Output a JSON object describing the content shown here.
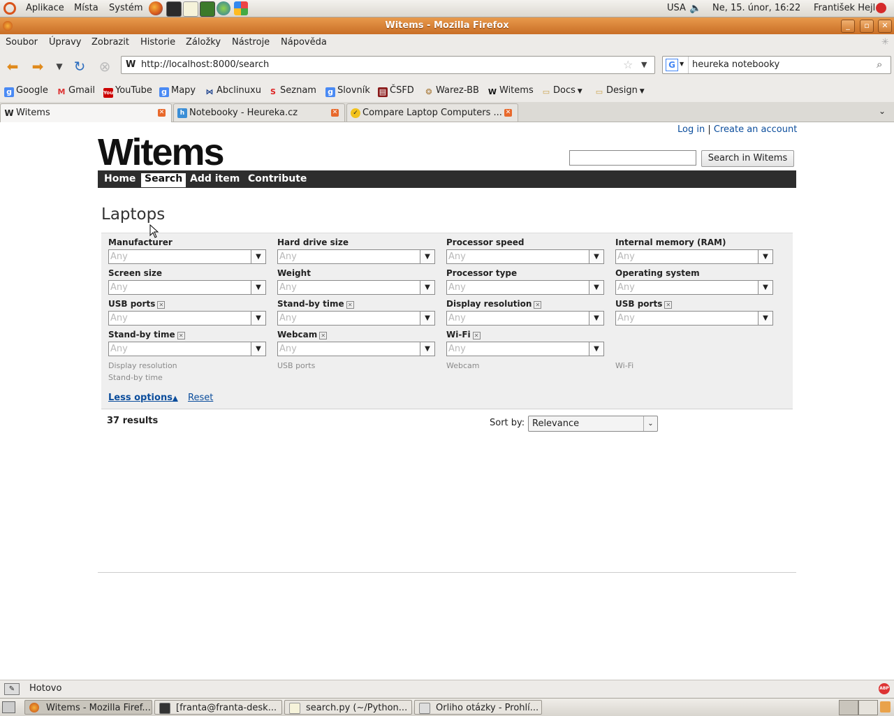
{
  "top_panel": {
    "menus": [
      "Aplikace",
      "Místa",
      "Systém"
    ],
    "keyboard": "USA",
    "datetime": "Ne, 15. únor, 16:22",
    "user": "František Hejl"
  },
  "window": {
    "title": "Witems - Mozilla Firefox"
  },
  "menu_bar": [
    "Soubor",
    "Úpravy",
    "Zobrazit",
    "Historie",
    "Záložky",
    "Nástroje",
    "Nápověda"
  ],
  "nav": {
    "url": "http://localhost:8000/search",
    "search_value": "heureka notebooky"
  },
  "bookmarks": [
    "Google",
    "Gmail",
    "YouTube",
    "Mapy",
    "Abclinuxu",
    "Seznam",
    "Slovník",
    "ČSFD",
    "Warez-BB",
    "Witems",
    "Docs",
    "Design"
  ],
  "tabs": [
    {
      "label": "Witems"
    },
    {
      "label": "Notebooky - Heureka.cz"
    },
    {
      "label": "Compare Laptop Computers ..."
    }
  ],
  "page": {
    "login": "Log in",
    "separator": "|",
    "create_account": "Create an account",
    "logo": "Witems",
    "search_button": "Search in Witems",
    "site_nav": [
      "Home",
      "Search",
      "Add item",
      "Contribute"
    ],
    "title": "Laptops",
    "filters": [
      {
        "label": "Manufacturer",
        "value": "Any",
        "removable": false
      },
      {
        "label": "Hard drive size",
        "value": "Any",
        "removable": false
      },
      {
        "label": "Processor speed",
        "value": "Any",
        "removable": false
      },
      {
        "label": "Internal memory (RAM)",
        "value": "Any",
        "removable": false
      },
      {
        "label": "Screen size",
        "value": "Any",
        "removable": false
      },
      {
        "label": "Weight",
        "value": "Any",
        "removable": false
      },
      {
        "label": "Processor type",
        "value": "Any",
        "removable": false
      },
      {
        "label": "Operating system",
        "value": "Any",
        "removable": false
      },
      {
        "label": "USB ports",
        "value": "Any",
        "removable": true
      },
      {
        "label": "Stand-by time",
        "value": "Any",
        "removable": true
      },
      {
        "label": "Display resolution",
        "value": "Any",
        "removable": true
      },
      {
        "label": "USB ports",
        "value": "Any",
        "removable": true
      },
      {
        "label": "Stand-by time",
        "value": "Any",
        "removable": true
      },
      {
        "label": "Webcam",
        "value": "Any",
        "removable": true
      },
      {
        "label": "Wi-Fi",
        "value": "Any",
        "removable": true
      }
    ],
    "extra_options": [
      [
        "Display resolution",
        "Stand-by time"
      ],
      [
        "USB ports"
      ],
      [
        "Webcam"
      ],
      [
        "Wi-Fi"
      ]
    ],
    "less_options": "Less options",
    "reset": "Reset",
    "results": "37 results",
    "sort_label": "Sort by:",
    "sort_value": "Relevance"
  },
  "status": "Hotovo",
  "taskbar": [
    "Witems - Mozilla Firef...",
    "[franta@franta-desk...",
    "search.py (~/Python...",
    "Orliho otázky - Prohlí..."
  ],
  "colors": {
    "link": "#0b4d9c",
    "nav_bg": "#2d2d2d",
    "title_bar": "#d97a30"
  }
}
